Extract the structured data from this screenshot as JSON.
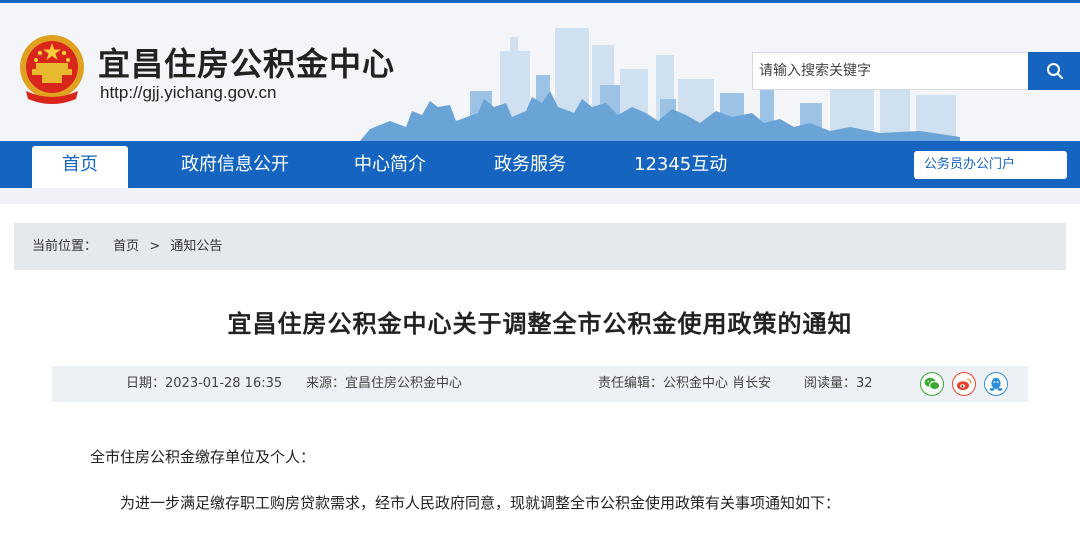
{
  "header": {
    "site_title": "宜昌住房公积金中心",
    "site_url": "http://gjj.yichang.gov.cn",
    "search_placeholder": "请输入搜索关键字"
  },
  "nav": {
    "items": [
      "首页",
      "政府信息公开",
      "中心简介",
      "政务服务",
      "12345互动"
    ],
    "active_index": 0,
    "portal_label": "公务员办公门户"
  },
  "breadcrumb": {
    "prefix": "当前位置：",
    "items": [
      "首页",
      ">",
      "通知公告"
    ]
  },
  "article": {
    "title": "宜昌住房公积金中心关于调整全市公积金使用政策的通知",
    "date": "日期：2023-01-28 16:35",
    "source": "来源：宜昌住房公积金中心",
    "editor": "责任编辑：公积金中心 肖长安",
    "views": "阅读量：32",
    "greeting": "全市住房公积金缴存单位及个人：",
    "paragraph1": "为进一步满足缴存职工购房贷款需求，经市人民政府同意，现就调整全市公积金使用政策有关事项通知如下："
  },
  "share": {
    "icons": [
      "wechat-icon",
      "weibo-icon",
      "qq-icon"
    ]
  },
  "colors": {
    "primary": "#1565c0",
    "wechat": "#3aaa35",
    "weibo": "#e6452c",
    "qq": "#2e8fd8"
  }
}
